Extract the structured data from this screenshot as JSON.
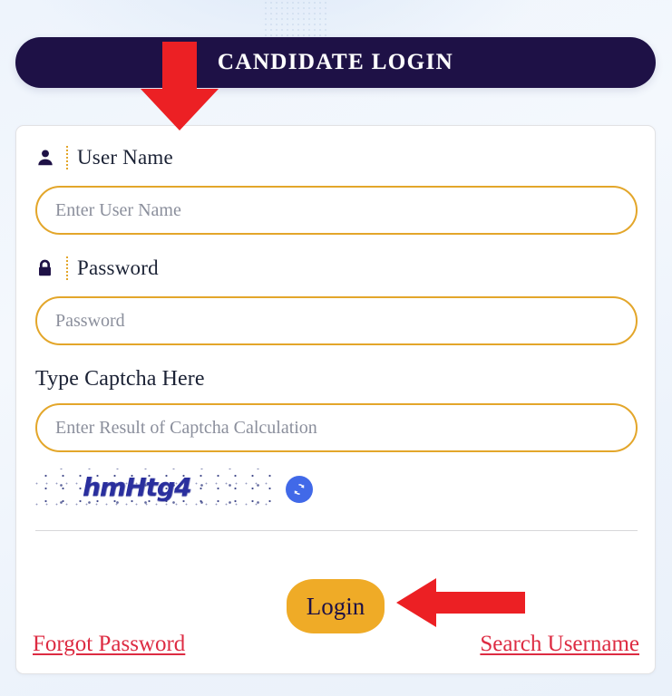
{
  "page": {
    "background_color": "#eef4fc",
    "accent_navy": "#1e1146",
    "accent_amber": "#e3a62a",
    "link_red": "#dd2b42",
    "arrow_red": "#ec2024"
  },
  "header": {
    "title": "CANDIDATE LOGIN",
    "background_color": "#1e1146",
    "text_color": "#ffffff"
  },
  "form": {
    "username": {
      "icon": "user-icon",
      "label": "User Name",
      "placeholder": "Enter User Name",
      "value": ""
    },
    "password": {
      "icon": "lock-icon",
      "label": "Password",
      "placeholder": "Password",
      "value": ""
    },
    "captcha": {
      "label": "Type Captcha Here",
      "placeholder": "Enter Result of Captcha Calculation",
      "value": "",
      "image_text": "hmHtg4",
      "refresh_icon": "refresh-icon",
      "refresh_button_color": "#4169e8"
    }
  },
  "actions": {
    "login_label": "Login",
    "login_button_color": "#efab27",
    "login_text_color": "#1e1146",
    "forgot_password_label": "Forgot Password",
    "search_username_label": "Search Username"
  },
  "annotations": {
    "arrow_down": {
      "icon": "arrow-down-icon",
      "color": "#ec2024",
      "points_at": "User Name"
    },
    "arrow_left": {
      "icon": "arrow-left-icon",
      "color": "#ec2024",
      "points_at": "Login"
    }
  }
}
